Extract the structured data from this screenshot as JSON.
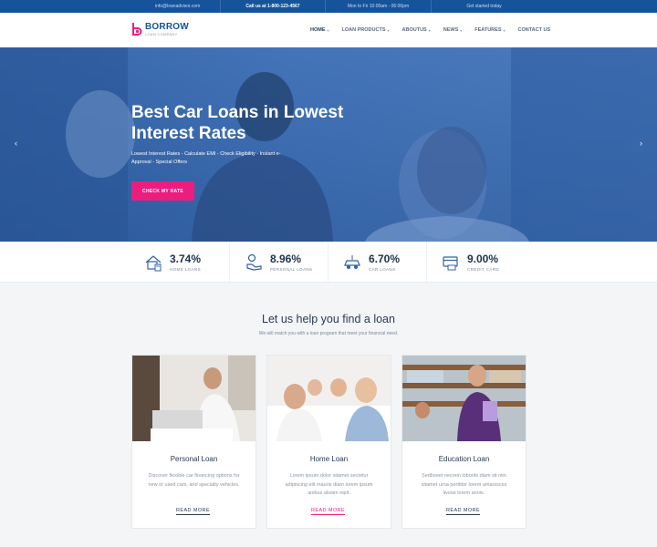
{
  "topbar": {
    "email": "info@loanadvisor.com",
    "phone": "Call us at 1-800-123-4567",
    "hours": "Mon to Fri 10:00am - 06:00pm",
    "cta": "Get started today"
  },
  "logo": {
    "name": "BORROW",
    "tagline": "LOAN COMPANY"
  },
  "menu": {
    "items": [
      {
        "label": "HOME"
      },
      {
        "label": "LOAN PRODUCTS"
      },
      {
        "label": "ABOUTUS"
      },
      {
        "label": "NEWS"
      },
      {
        "label": "FEATURES"
      },
      {
        "label": "CONTACT US"
      }
    ]
  },
  "hero": {
    "title": "Best Car Loans in Lowest Interest Rates",
    "subtitle": "Lowest Interest Rates - Calculate EMI - Check Eligibility - Instant e-Approval - Special Offers",
    "button": "CHECK MY RATE",
    "prev_icon": "chevron-left-icon",
    "next_icon": "chevron-right-icon"
  },
  "stats": [
    {
      "value": "3.74%",
      "label": "HOME LOANS",
      "icon": "house-calculator-icon"
    },
    {
      "value": "8.96%",
      "label": "PERSONAL LOANS",
      "icon": "hand-money-icon"
    },
    {
      "value": "6.70%",
      "label": "CAR LOANS",
      "icon": "car-icon"
    },
    {
      "value": "9.00%",
      "label": "CREDIT CARD",
      "icon": "credit-card-icon"
    }
  ],
  "section": {
    "title": "Let us help you find a loan",
    "subtitle": "We will match you with a loan program that meet your financial need."
  },
  "cards": [
    {
      "title": "Personal Loan",
      "text": "Discover flexible car financing options for new or used cars, and specialty vehicles.",
      "link": "READ MORE"
    },
    {
      "title": "Home Loan",
      "text": "Lorem ipsum dolor sitamet sectetur adipiscing elit mauris diam lorem ipsum anibus alsiam eipit.",
      "link": "READ MORE"
    },
    {
      "title": "Education Loan",
      "text": "Sedbseet necrein loborits diam sit nim sitamet urna porttitor lorem amarssces livose lorem anois.",
      "link": "READ MORE"
    }
  ],
  "colors": {
    "primary": "#15549a",
    "accent": "#ec1d7e",
    "active_link": "#ec1d7e"
  }
}
